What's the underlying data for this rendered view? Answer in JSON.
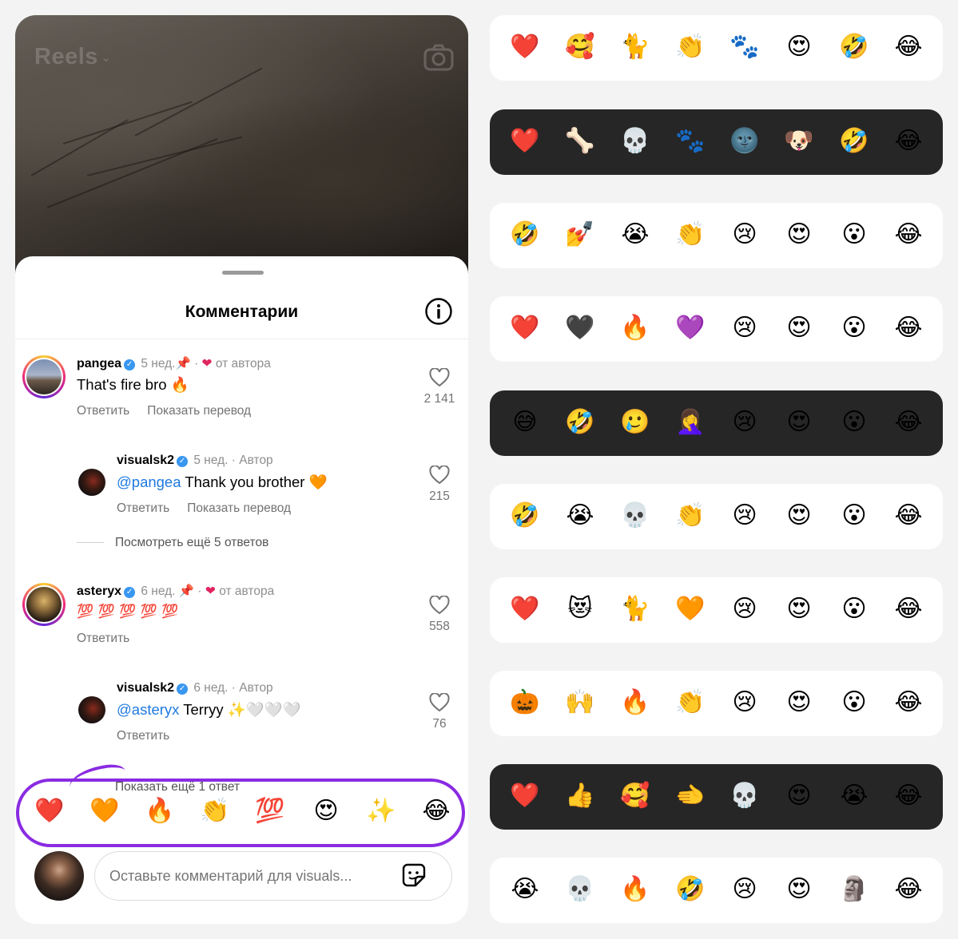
{
  "header": {
    "title": "Reels"
  },
  "sheet": {
    "title": "Комментарии",
    "comments": [
      {
        "user": "pangea",
        "time": "5 нед.",
        "pinned": true,
        "liked_by_author": "от автора",
        "text": "That's fire bro",
        "text_emoji": "🔥",
        "actions": [
          "Ответить",
          "Показать перевод"
        ],
        "likes": "2 141",
        "reply": {
          "user": "visualsk2",
          "time": "5 нед.",
          "role": "Автор",
          "mention": "@pangea",
          "text": "Thank you brother",
          "text_emoji": "🧡",
          "actions": [
            "Ответить",
            "Показать перевод"
          ],
          "likes": "215"
        },
        "more": "Посмотреть ещё 5 ответов"
      },
      {
        "user": "asteryx",
        "time": "6 нед.",
        "pinned": true,
        "liked_by_author": "от автора",
        "text_emoji": "💯 💯 💯 💯 💯",
        "actions": [
          "Ответить"
        ],
        "likes": "558",
        "reply": {
          "user": "visualsk2",
          "time": "6 нед.",
          "role": "Автор",
          "mention": "@asteryx",
          "text": "Terryy",
          "text_emoji": "✨🤍🤍🤍",
          "actions": [
            "Ответить"
          ],
          "likes": "76"
        },
        "more": "Показать ещё 1 ответ"
      }
    ],
    "quick_reactions": [
      "❤️",
      "🧡",
      "🔥",
      "👏",
      "💯",
      "😍",
      "✨",
      "😂"
    ],
    "composer": {
      "placeholder": "Оставьте комментарий для visuals..."
    }
  },
  "reaction_bars": [
    {
      "theme": "light",
      "emojis": [
        "❤️",
        "🥰",
        "🐈",
        "👏",
        "🐾",
        "😍",
        "🤣",
        "😂"
      ]
    },
    {
      "theme": "dark",
      "emojis": [
        "❤️",
        "🦴",
        "💀",
        "🐾",
        "🌚",
        "🐶",
        "🤣",
        "😂"
      ]
    },
    {
      "theme": "light",
      "emojis": [
        "🤣",
        "💅",
        "😭",
        "👏",
        "😢",
        "😍",
        "😮",
        "😂"
      ]
    },
    {
      "theme": "light",
      "emojis": [
        "❤️",
        "🖤",
        "🔥",
        "💜",
        "😢",
        "😍",
        "😮",
        "😂"
      ]
    },
    {
      "theme": "dark",
      "emojis": [
        "😅",
        "🤣",
        "🥲",
        "🤦‍♀️",
        "😢",
        "😍",
        "😮",
        "😂"
      ]
    },
    {
      "theme": "light",
      "emojis": [
        "🤣",
        "😭",
        "💀",
        "👏",
        "😢",
        "😍",
        "😮",
        "😂"
      ]
    },
    {
      "theme": "light",
      "emojis": [
        "❤️",
        "😻",
        "🐈",
        "🧡",
        "😢",
        "😍",
        "😮",
        "😂"
      ]
    },
    {
      "theme": "light",
      "emojis": [
        "🎃",
        "🙌",
        "🔥",
        "👏",
        "😢",
        "😍",
        "😮",
        "😂"
      ]
    },
    {
      "theme": "dark",
      "emojis": [
        "❤️",
        "👍",
        "🥰",
        "🫲",
        "💀",
        "😍",
        "😭",
        "😂"
      ]
    },
    {
      "theme": "light",
      "emojis": [
        "😭",
        "💀",
        "🔥",
        "🤣",
        "😢",
        "😍",
        "🗿",
        "😂"
      ]
    }
  ]
}
